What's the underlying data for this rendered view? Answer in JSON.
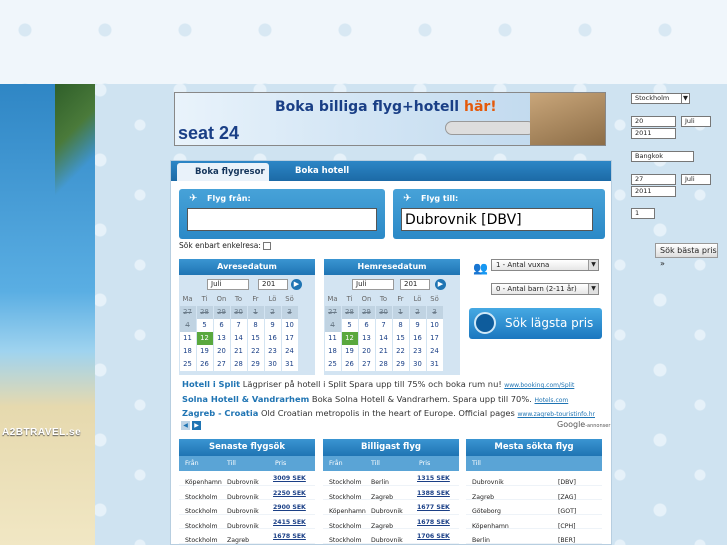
{
  "banner": {
    "slogan_prefix": "Boka billiga flyg+hotell ",
    "slogan_highlight": "här!",
    "logo": "seat 24"
  },
  "beach_logo": "A2BTRAVEL.se",
  "tabs": {
    "flights": "Boka flygresor",
    "hotels": "Boka hotell"
  },
  "from": {
    "label": "Flyg från:",
    "value": ""
  },
  "to": {
    "label": "Flyg till:",
    "value": "Dubrovnik [DBV]"
  },
  "oneway_label": "Sök enbart enkelresa:",
  "depart": {
    "title": "Avresedatum",
    "month": "Juli",
    "year": "201"
  },
  "return": {
    "title": "Hemresedatum",
    "month": "Juli",
    "year": "201"
  },
  "weekdays": [
    "Ma",
    "Ti",
    "On",
    "To",
    "Fr",
    "Lö",
    "Sö"
  ],
  "calendar_weeks": [
    [
      {
        "d": "27",
        "s": "p"
      },
      {
        "d": "28",
        "s": "p"
      },
      {
        "d": "29",
        "s": "p"
      },
      {
        "d": "30",
        "s": "p"
      },
      {
        "d": "1",
        "s": "p"
      },
      {
        "d": "2",
        "s": "p"
      },
      {
        "d": "3",
        "s": "p"
      }
    ],
    [
      {
        "d": "4",
        "s": "p"
      },
      {
        "d": "5",
        "s": ""
      },
      {
        "d": "6",
        "s": ""
      },
      {
        "d": "7",
        "s": ""
      },
      {
        "d": "8",
        "s": ""
      },
      {
        "d": "9",
        "s": ""
      },
      {
        "d": "10",
        "s": ""
      }
    ],
    [
      {
        "d": "11",
        "s": ""
      },
      {
        "d": "12",
        "s": "t"
      },
      {
        "d": "13",
        "s": ""
      },
      {
        "d": "14",
        "s": ""
      },
      {
        "d": "15",
        "s": ""
      },
      {
        "d": "16",
        "s": ""
      },
      {
        "d": "17",
        "s": ""
      }
    ],
    [
      {
        "d": "18",
        "s": ""
      },
      {
        "d": "19",
        "s": ""
      },
      {
        "d": "20",
        "s": ""
      },
      {
        "d": "21",
        "s": ""
      },
      {
        "d": "22",
        "s": ""
      },
      {
        "d": "23",
        "s": ""
      },
      {
        "d": "24",
        "s": ""
      }
    ],
    [
      {
        "d": "25",
        "s": ""
      },
      {
        "d": "26",
        "s": ""
      },
      {
        "d": "27",
        "s": ""
      },
      {
        "d": "28",
        "s": ""
      },
      {
        "d": "29",
        "s": ""
      },
      {
        "d": "30",
        "s": ""
      },
      {
        "d": "31",
        "s": ""
      }
    ]
  ],
  "adults": "1 - Antal vuxna",
  "children": "0 - Antal barn (2-11 år)",
  "search_button": "Sök lägsta pris",
  "ads": [
    {
      "title": "Hotell i Split",
      "text": " Lägpriser på hotell i Split Spara upp till 75% och boka rum nu!",
      "src": "www.booking.com/Split"
    },
    {
      "title": "Solna Hotell & Vandrarhem",
      "text": " Boka Solna Hotell & Vandrarhem. Spara upp till 70%.",
      "src": "Hotels.com"
    },
    {
      "title": "Zagreb - Croatia",
      "text": " Old Croatian metropolis in the heart of Europe. Official pages",
      "src": "www.zagreb-touristinfo.hr"
    }
  ],
  "google_label": "Google",
  "google_suffix": "-annonser",
  "recent": {
    "title": "Senaste flygsök",
    "cols": [
      "Från",
      "Till",
      "Pris"
    ],
    "rows": [
      [
        "Köpenhamn",
        "Dubrovnik",
        "3009 SEK"
      ],
      [
        "Stockholm",
        "Dubrovnik",
        "2250 SEK"
      ],
      [
        "Stockholm",
        "Dubrovnik",
        "2900 SEK"
      ],
      [
        "Stockholm",
        "Dubrovnik",
        "2415 SEK"
      ],
      [
        "Stockholm",
        "Zagreb",
        "1678 SEK"
      ]
    ]
  },
  "cheapest": {
    "title": "Billigast flyg",
    "cols": [
      "Från",
      "Till",
      "Pris"
    ],
    "rows": [
      [
        "Stockholm",
        "Berlin",
        "1315 SEK"
      ],
      [
        "Stockholm",
        "Zagreb",
        "1388 SEK"
      ],
      [
        "Köpenhamn",
        "Dubrovnik",
        "1677 SEK"
      ],
      [
        "Stockholm",
        "Zagreb",
        "1678 SEK"
      ],
      [
        "Stockholm",
        "Dubrovnik",
        "1706 SEK"
      ]
    ]
  },
  "popular": {
    "title": "Mesta sökta flyg",
    "cols": [
      "Till"
    ],
    "rows": [
      [
        "Dubrovnik",
        "[DBV]"
      ],
      [
        "Zagreb",
        "[ZAG]"
      ],
      [
        "Göteborg",
        "[GOT]"
      ],
      [
        "Köpenhamn",
        "[CPH]"
      ],
      [
        "Berlin",
        "[BER]"
      ]
    ]
  },
  "side": {
    "from_city": "Stockholm",
    "dep_day": "20",
    "dep_month": "Juli",
    "dep_year": "2011",
    "to_city": "Bangkok",
    "ret_day": "27",
    "ret_month": "Juli",
    "ret_year": "2011",
    "pax": "1",
    "button": "Sök bästa pris »"
  }
}
